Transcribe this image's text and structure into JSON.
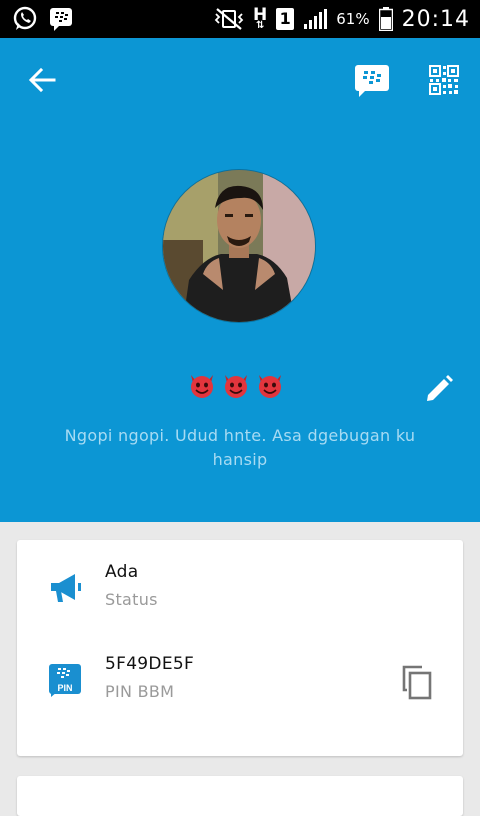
{
  "status_bar": {
    "battery_percent": "61%",
    "time": "20:14",
    "sim_label": "1",
    "network_type": "H",
    "icons": [
      "whatsapp-icon",
      "bbm-notification-icon",
      "vibrate-off-icon",
      "network-type-icon",
      "sim-icon",
      "signal-icon",
      "battery-icon"
    ]
  },
  "toolbar": {
    "back_icon": "arrow-left-icon",
    "chat_icon": "bbm-chat-icon",
    "qr_icon": "qr-code-icon"
  },
  "profile": {
    "emoji": [
      "😈",
      "😈",
      "😈"
    ],
    "status_message": "Ngopi ngopi. Udud hnte. Asa dgebugan ku hansip",
    "edit_icon": "pencil-icon"
  },
  "details": {
    "status": {
      "value": "Ada",
      "label": "Status",
      "icon": "megaphone-icon"
    },
    "pin": {
      "value": "5F49DE5F",
      "label": "PIN BBM",
      "icon": "bbm-pin-icon",
      "copy_icon": "copy-icon"
    }
  },
  "colors": {
    "header_bg": "#0c96d4",
    "accent": "#1a8fd0",
    "status_text": "#a7dbf3"
  }
}
